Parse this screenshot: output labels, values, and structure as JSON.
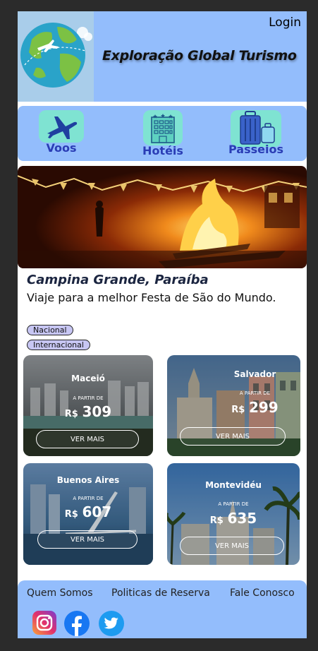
{
  "header": {
    "brand": "Exploração Global Turismo",
    "login_label": "Login"
  },
  "nav": {
    "items": [
      {
        "label": "Voos",
        "icon": "airplane-icon"
      },
      {
        "label": "Hotéis",
        "icon": "hotel-icon"
      },
      {
        "label": "Passeios",
        "icon": "luggage-icon"
      }
    ]
  },
  "hero": {
    "title": "Campina Grande, Paraíba",
    "subtitle": "Viaje para a melhor Festa de São do Mundo."
  },
  "filters": [
    "Nacional",
    "Internacional"
  ],
  "cards": [
    {
      "city": "Maceió",
      "from": "A PARTIR DE",
      "currency": "R$",
      "price": "309",
      "button": "VER MAIS"
    },
    {
      "city": "Salvador",
      "from": "A PARTIR DE",
      "currency": "R$",
      "price": "299",
      "button": "VER MAIS"
    },
    {
      "city": "Buenos Aires",
      "from": "A PARTIR DE",
      "currency": "R$",
      "price": "607",
      "button": "VER MAIS"
    },
    {
      "city": "Montevidéu",
      "from": "A PARTIR DE",
      "currency": "R$",
      "price": "635",
      "button": "VER MAIS"
    }
  ],
  "footer": {
    "links": [
      "Quem Somos",
      "Politicas de Reserva",
      "Fale Conosco"
    ],
    "social": [
      "instagram-icon",
      "facebook-icon",
      "twitter-icon"
    ]
  },
  "colors": {
    "header_bg": "#93bdfc",
    "nav_label": "#2a3db5",
    "chip_bg": "#c7c6f3",
    "page_bg": "#2b2b2b"
  }
}
